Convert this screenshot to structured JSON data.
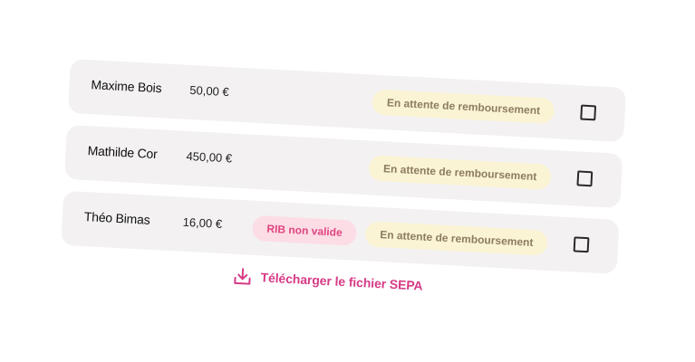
{
  "rows": [
    {
      "name": "Maxime Bois",
      "amount": "50,00 €",
      "error_badge": "",
      "status": "En attente de remboursement"
    },
    {
      "name": "Mathilde Cor",
      "amount": "450,00 €",
      "error_badge": "",
      "status": "En attente de remboursement"
    },
    {
      "name": "Théo Bimas",
      "amount": "16,00 €",
      "error_badge": "RIB non valide",
      "status": "En attente de remboursement"
    }
  ],
  "download": {
    "label": "Télécharger le fichier SEPA",
    "icon": "download-icon"
  },
  "colors": {
    "row_background": "#f3f1f1",
    "pending_badge_bg": "#fbf4d4",
    "pending_badge_text": "#8c7c63",
    "error_badge_bg": "#fcdde6",
    "error_badge_text": "#e0467f",
    "accent": "#d63b86"
  }
}
